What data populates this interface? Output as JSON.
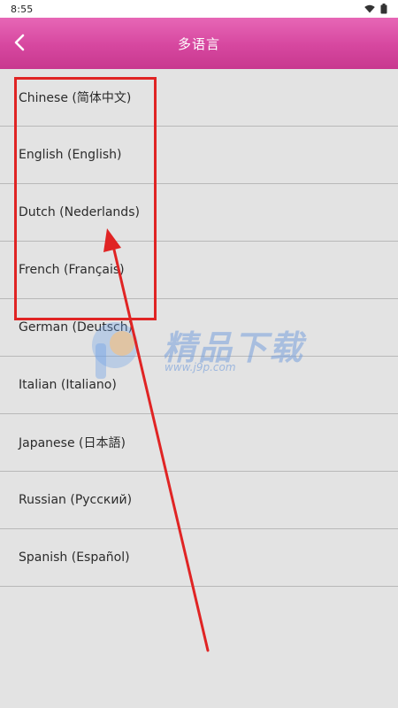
{
  "status_bar": {
    "time": "8:55",
    "icons": [
      "wifi-icon",
      "battery-icon"
    ]
  },
  "header": {
    "title": "多语言",
    "back_icon": "chevron-left-icon",
    "gradient_colors": [
      "#e767b6",
      "#c8388f"
    ]
  },
  "languages": [
    {
      "label": "Chinese (简体中文)"
    },
    {
      "label": "English (English)"
    },
    {
      "label": "Dutch (Nederlands)"
    },
    {
      "label": "French (Français)"
    },
    {
      "label": "German (Deutsch)"
    },
    {
      "label": "Italian (Italiano)"
    },
    {
      "label": "Japanese (日本語)"
    },
    {
      "label": "Russian (Русский)"
    },
    {
      "label": "Spanish (Español)"
    }
  ],
  "watermark": {
    "text": "精品下载",
    "url": "www.j9p.com"
  },
  "annotation": {
    "color": "#e02424"
  }
}
